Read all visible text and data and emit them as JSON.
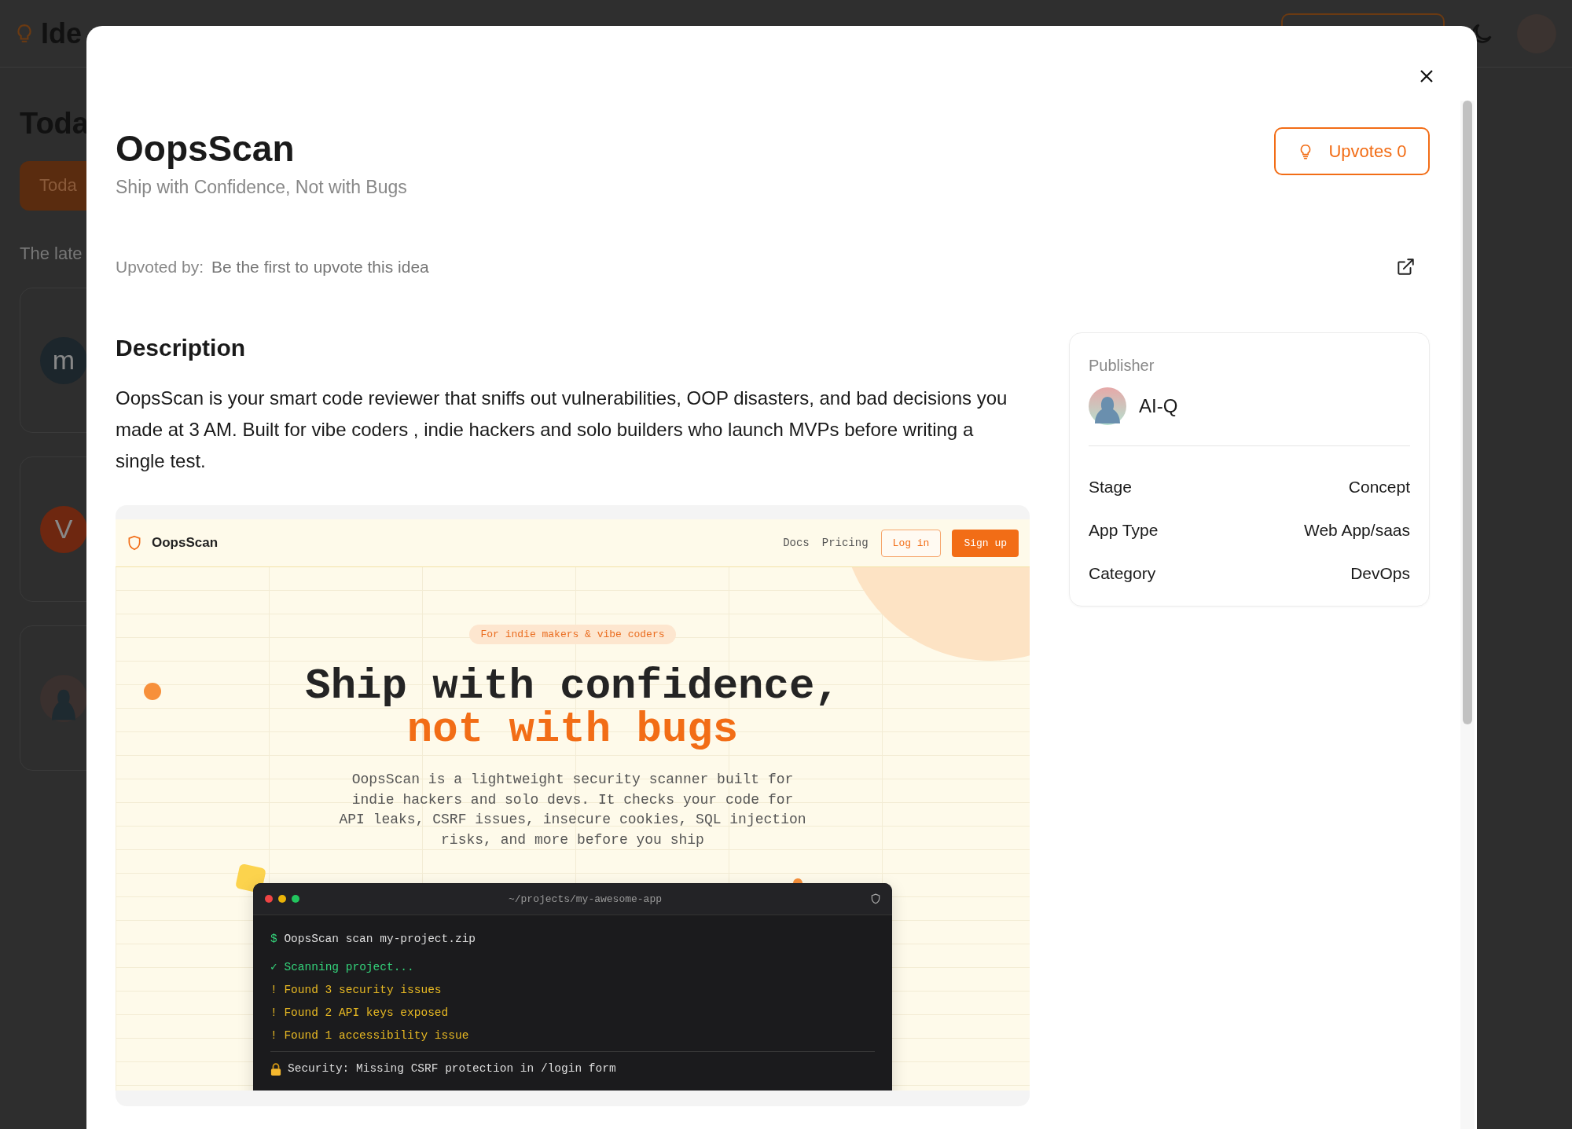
{
  "background_page": {
    "logo_text": "Ide",
    "heading": "Toda",
    "tab": {
      "label": "Toda",
      "selected": true
    },
    "intro": "The late",
    "cards": [
      {
        "kind": "letter",
        "letter": "m",
        "color": "#1c262c"
      },
      {
        "kind": "letter",
        "letter": "V",
        "color": "#6e2710"
      },
      {
        "kind": "photo"
      }
    ]
  },
  "modal": {
    "title": "OopsScan",
    "subtitle": "Ship with Confidence, Not with Bugs",
    "upvote_button": "Upvotes 0",
    "upvoted_by_label": "Upvoted by:",
    "upvoted_by_value": "Be the first to upvote this idea",
    "description_heading": "Description",
    "description": "OopsScan is your smart code reviewer that sniffs out vulnerabilities, OOP disasters, and bad decisions you made at 3 AM. Built for vibe coders , indie hackers and solo builders who launch MVPs before writing a single test.",
    "preview": {
      "brand": "OopsScan",
      "nav_links": [
        "Docs",
        "Pricing"
      ],
      "login_button": "Log in",
      "signup_button": "Sign up",
      "badge": "For indie makers & vibe coders",
      "headline_lines": [
        {
          "text": "Ship with confidence,",
          "accent": false
        },
        {
          "text": "not with bugs",
          "accent": true
        }
      ],
      "blurb": "OopsScan is a lightweight security scanner built for indie hackers and solo devs. It checks your code for API leaks, CSRF issues, insecure cookies, SQL injection risks, and more before you ship",
      "terminal": {
        "title": "~/projects/my-awesome-app",
        "lines": [
          {
            "kind": "command",
            "marker": "$",
            "text": "OopsScan scan my-project.zip"
          },
          {
            "kind": "success",
            "marker": "✓",
            "text": "Scanning project..."
          },
          {
            "kind": "warning",
            "marker": "!",
            "text": "Found 3 security issues"
          },
          {
            "kind": "warning",
            "marker": "!",
            "text": "Found 2 API keys exposed"
          },
          {
            "kind": "warning",
            "marker": "!",
            "text": "Found 1 accessibility issue"
          },
          {
            "kind": "finding",
            "text": "Security: Missing CSRF protection in /login form"
          }
        ]
      }
    },
    "publisher": {
      "label": "Publisher",
      "name": "AI-Q",
      "details": [
        {
          "label": "Stage",
          "value": "Concept"
        },
        {
          "label": "App Type",
          "value": "Web App/saas"
        },
        {
          "label": "Category",
          "value": "DevOps"
        }
      ]
    }
  }
}
